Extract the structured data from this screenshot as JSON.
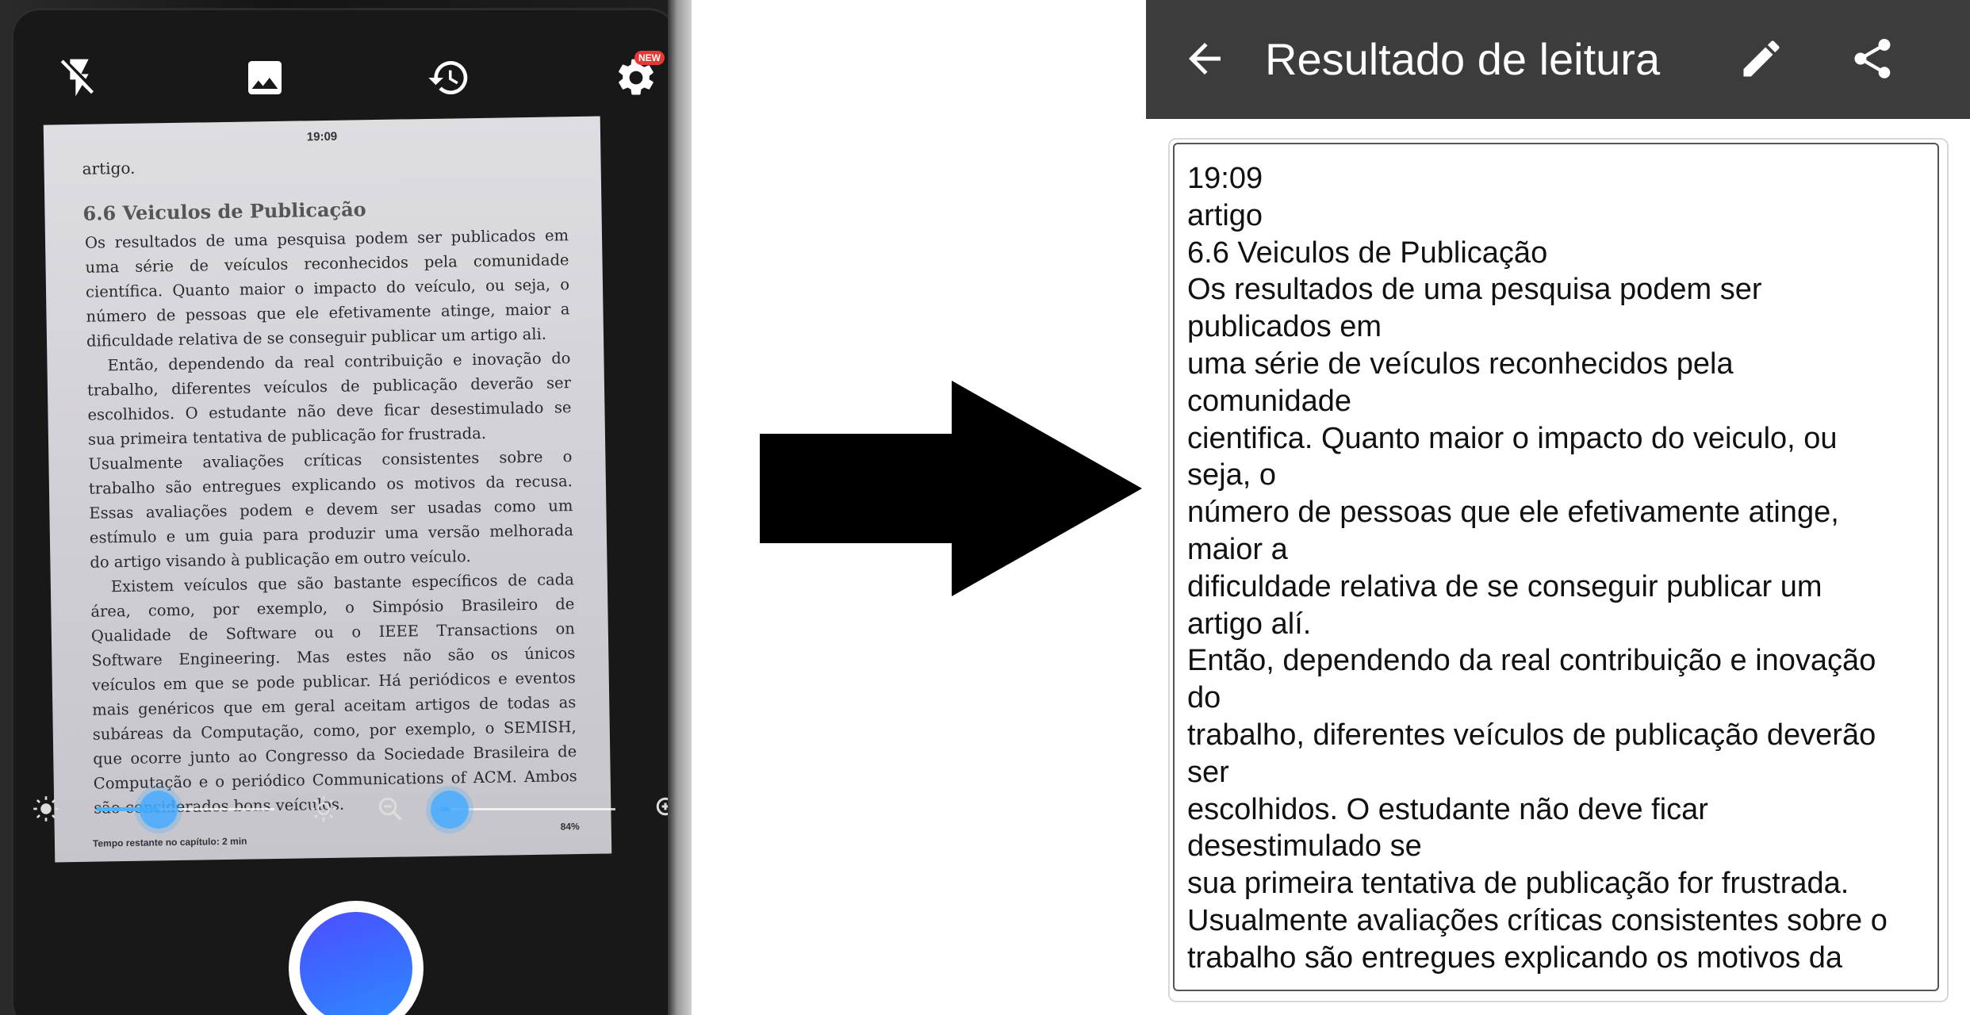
{
  "camera": {
    "toolbar": {
      "flash_icon": "flash-off-icon",
      "gallery_icon": "gallery-icon",
      "history_icon": "history-icon",
      "settings_icon": "settings-icon",
      "settings_badge": "NEW"
    },
    "page": {
      "clock": "19:09",
      "top_word": "artigo.",
      "heading": "6.6 Veiculos de Publicação",
      "lines": [
        {
          "text": "Os resultados de uma pesquisa podem ser publicados em",
          "indent": false
        },
        {
          "text": "uma série de veículos reconhecidos pela comunidade",
          "indent": false
        },
        {
          "text": "científica. Quanto maior o impacto do veículo, ou seja, o",
          "indent": false
        },
        {
          "text": "número de pessoas que ele efetivamente atinge, maior a",
          "indent": false
        },
        {
          "text": "dificuldade relativa de se conseguir publicar um artigo ali.",
          "indent": false,
          "last": true
        },
        {
          "text": "Então, dependendo da real contribuição e inovação do",
          "indent": true
        },
        {
          "text": "trabalho, diferentes veículos de publicação deverão ser",
          "indent": false
        },
        {
          "text": "escolhidos. O estudante não deve ficar desestimulado se",
          "indent": false
        },
        {
          "text": "sua primeira tentativa de publicação for frustrada.",
          "indent": false,
          "last": true
        },
        {
          "text": "Usualmente avaliações críticas consistentes sobre o",
          "indent": false
        },
        {
          "text": "trabalho são entregues explicando os motivos da recusa.",
          "indent": false
        },
        {
          "text": "Essas avaliações podem e devem ser usadas como um",
          "indent": false
        },
        {
          "text": "estímulo e um guia para produzir uma versão melhorada",
          "indent": false
        },
        {
          "text": "do artigo visando à publicação em outro veículo.",
          "indent": false,
          "last": true
        },
        {
          "text": "Existem veículos que são bastante específicos de cada",
          "indent": true
        },
        {
          "text": "área, como, por exemplo, o Simpósio Brasileiro de",
          "indent": false
        },
        {
          "text": "Qualidade de Software ou o IEEE Transactions on",
          "indent": false
        },
        {
          "text": "Software Engineering. Mas estes não são os únicos",
          "indent": false
        },
        {
          "text": "veículos em que se pode publicar. Há periódicos e eventos",
          "indent": false
        },
        {
          "text": "mais genéricos que em geral aceitam artigos de todas as",
          "indent": false
        },
        {
          "text": "subáreas da Computação, como, por exemplo, o SEMISH,",
          "indent": false
        },
        {
          "text": "que ocorre junto ao Congresso da Sociedade Brasileira de",
          "indent": false
        },
        {
          "text": "Computação e o periódico Communications of ACM. Ambos",
          "indent": false
        },
        {
          "text": "são considerados bons veículos.",
          "indent": false,
          "last": true
        }
      ],
      "footer_left": "Tempo restante no capítulo: 2 min",
      "footer_right": "84%"
    },
    "brightness_level": 0.35,
    "zoom_level": 0.05,
    "shutter_color": "#3a6cff"
  },
  "result": {
    "title": "Resultado de leitura",
    "back_icon": "arrow-back-icon",
    "edit_icon": "pencil-icon",
    "share_icon": "share-icon",
    "text_lines": [
      "19:09",
      "artigo",
      "6.6 Veiculos de Publicação",
      "Os resultados de uma pesquisa podem ser",
      "publicados em",
      "uma série de veículos reconhecidos pela",
      "comunidade",
      "cientifica. Quanto maior o impacto do veiculo, ou",
      "seja, o",
      "número de pessoas que ele efetivamente atinge,",
      "maior a",
      "dificuldade relativa de se conseguir publicar um",
      "artigo alí.",
      "Então, dependendo da real contribuição e inovação",
      "do",
      "trabalho, diferentes veículos de publicação deverão",
      "ser",
      "escolhidos. O estudante não deve ficar",
      "desestimulado se",
      "sua primeira tentativa de publicação for frustrada.",
      "Usualmente avaliações críticas consistentes sobre o",
      "trabalho são entregues explicando os motivos da"
    ]
  }
}
